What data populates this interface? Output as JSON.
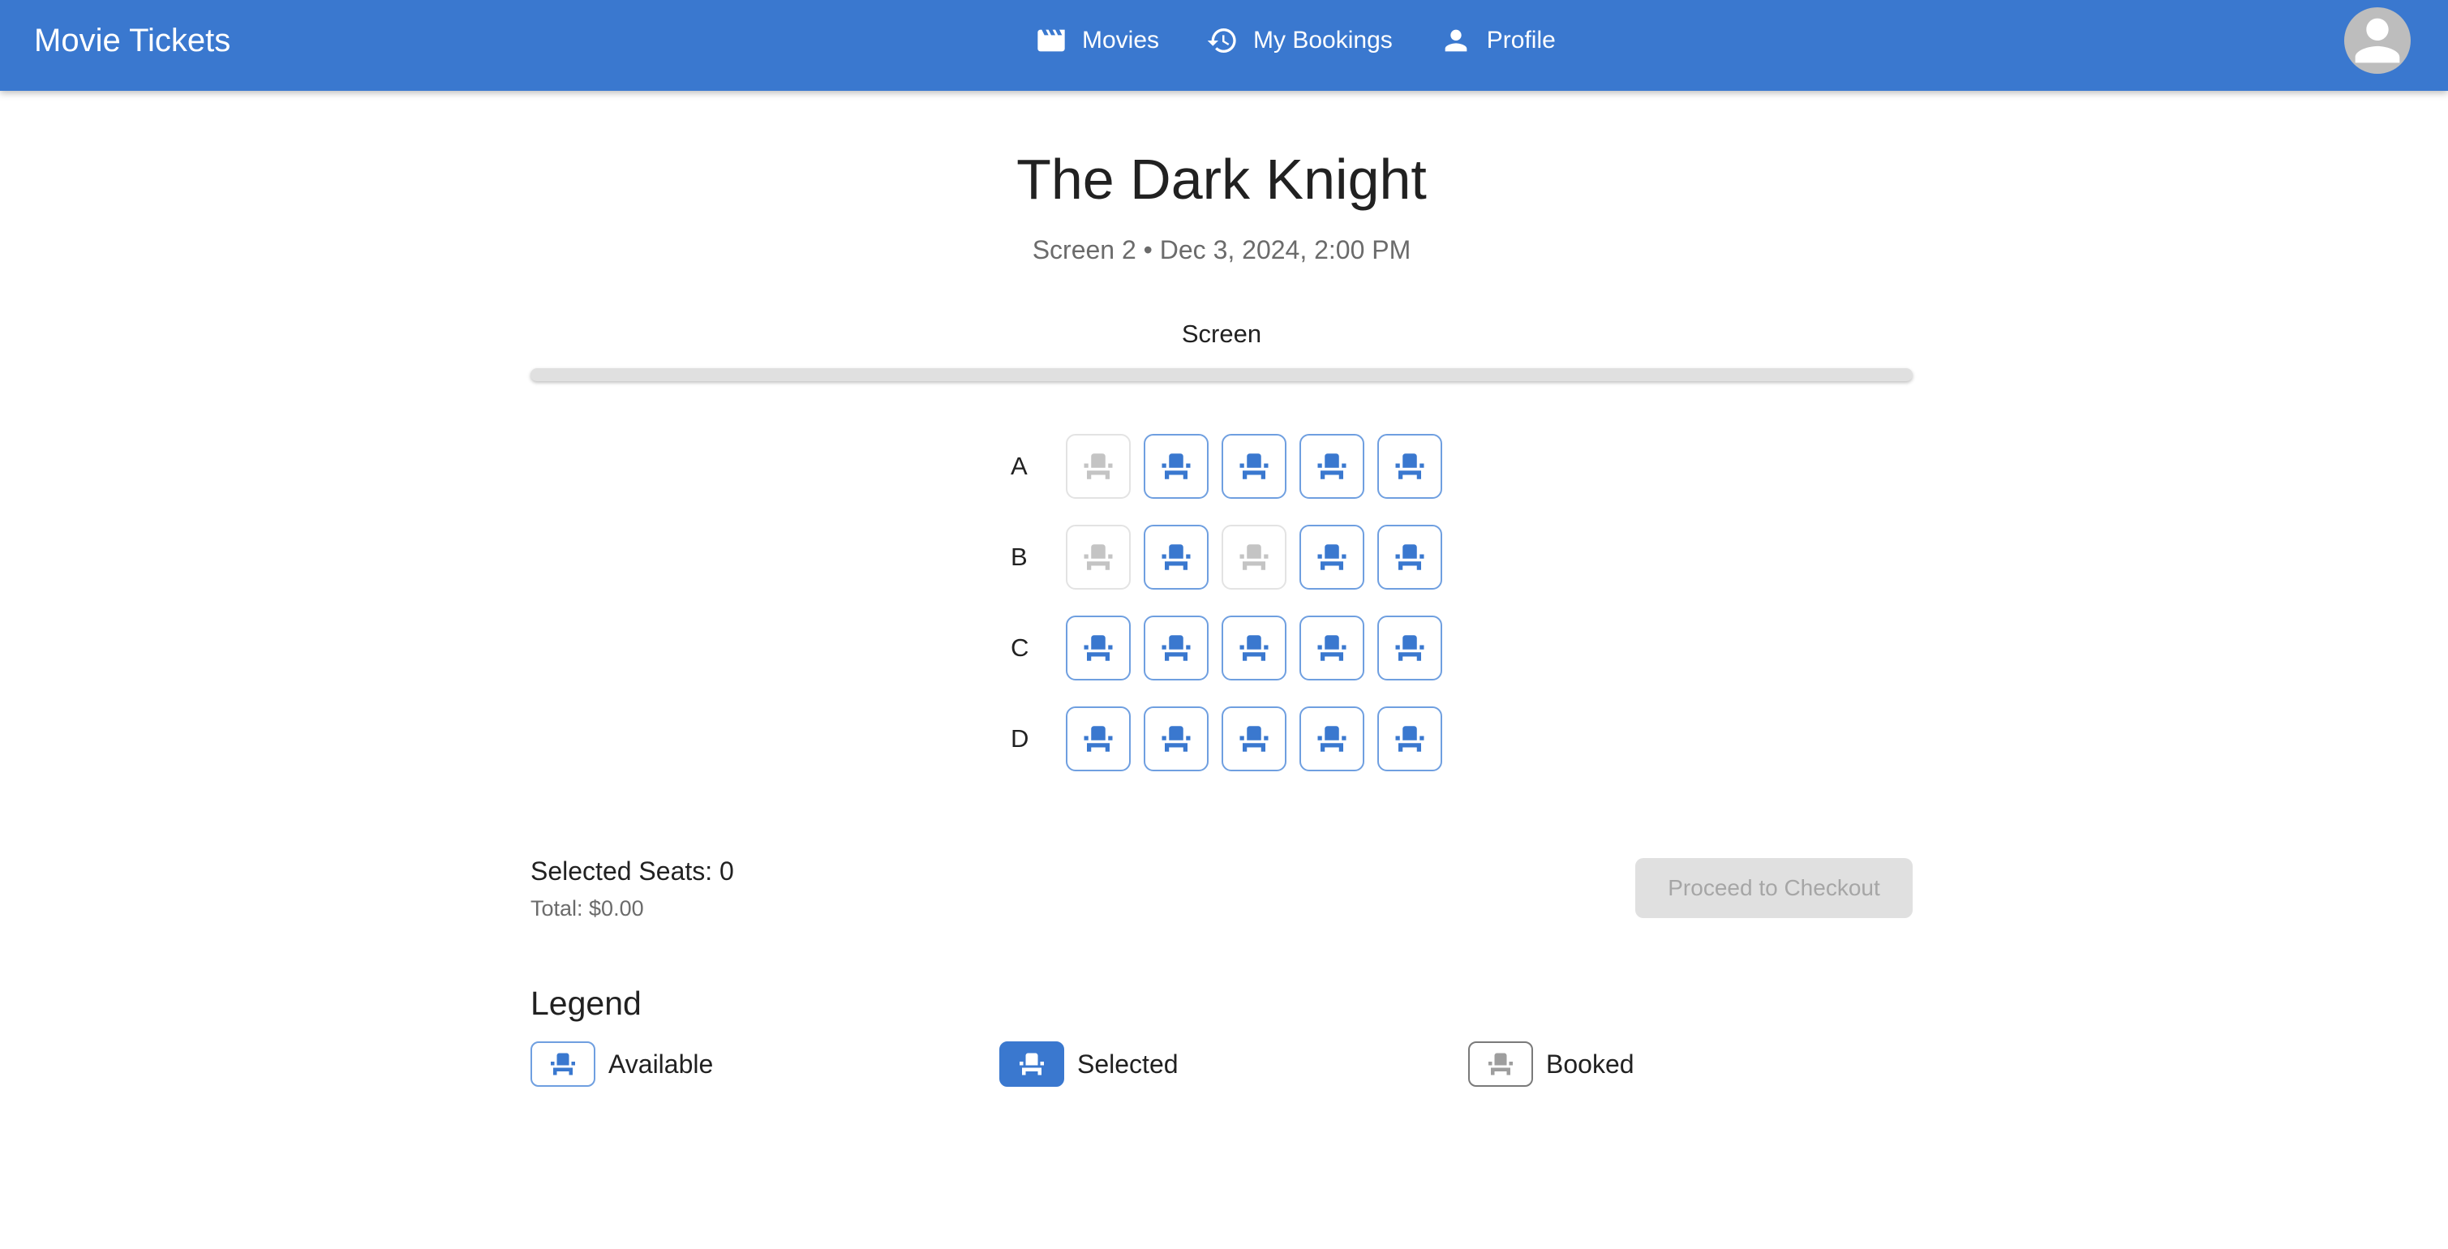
{
  "appbar": {
    "title": "Movie Tickets",
    "nav": [
      {
        "label": "Movies",
        "icon": "movie-icon"
      },
      {
        "label": "My Bookings",
        "icon": "history-icon"
      },
      {
        "label": "Profile",
        "icon": "person-icon"
      }
    ],
    "avatar_icon": "avatar-icon"
  },
  "movie": {
    "title": "The Dark Knight",
    "showtime": "Screen 2 • Dec 3, 2024, 2:00 PM"
  },
  "screen": {
    "label": "Screen"
  },
  "seat_map": {
    "rows": [
      {
        "label": "A",
        "seats": [
          "booked",
          "available",
          "available",
          "available",
          "available"
        ]
      },
      {
        "label": "B",
        "seats": [
          "booked",
          "available",
          "booked",
          "available",
          "available"
        ]
      },
      {
        "label": "C",
        "seats": [
          "available",
          "available",
          "available",
          "available",
          "available"
        ]
      },
      {
        "label": "D",
        "seats": [
          "available",
          "available",
          "available",
          "available",
          "available"
        ]
      }
    ]
  },
  "summary": {
    "selected_label": "Selected Seats: 0",
    "total_label": "Total: $0.00",
    "checkout_label": "Proceed to Checkout"
  },
  "legend": {
    "title": "Legend",
    "items": [
      {
        "label": "Available",
        "state": "available"
      },
      {
        "label": "Selected",
        "state": "selected"
      },
      {
        "label": "Booked",
        "state": "booked"
      }
    ]
  },
  "colors": {
    "primary": "#3a78cf",
    "booked": "#c4c4c4",
    "disabled_button": "#e0e0e0"
  }
}
